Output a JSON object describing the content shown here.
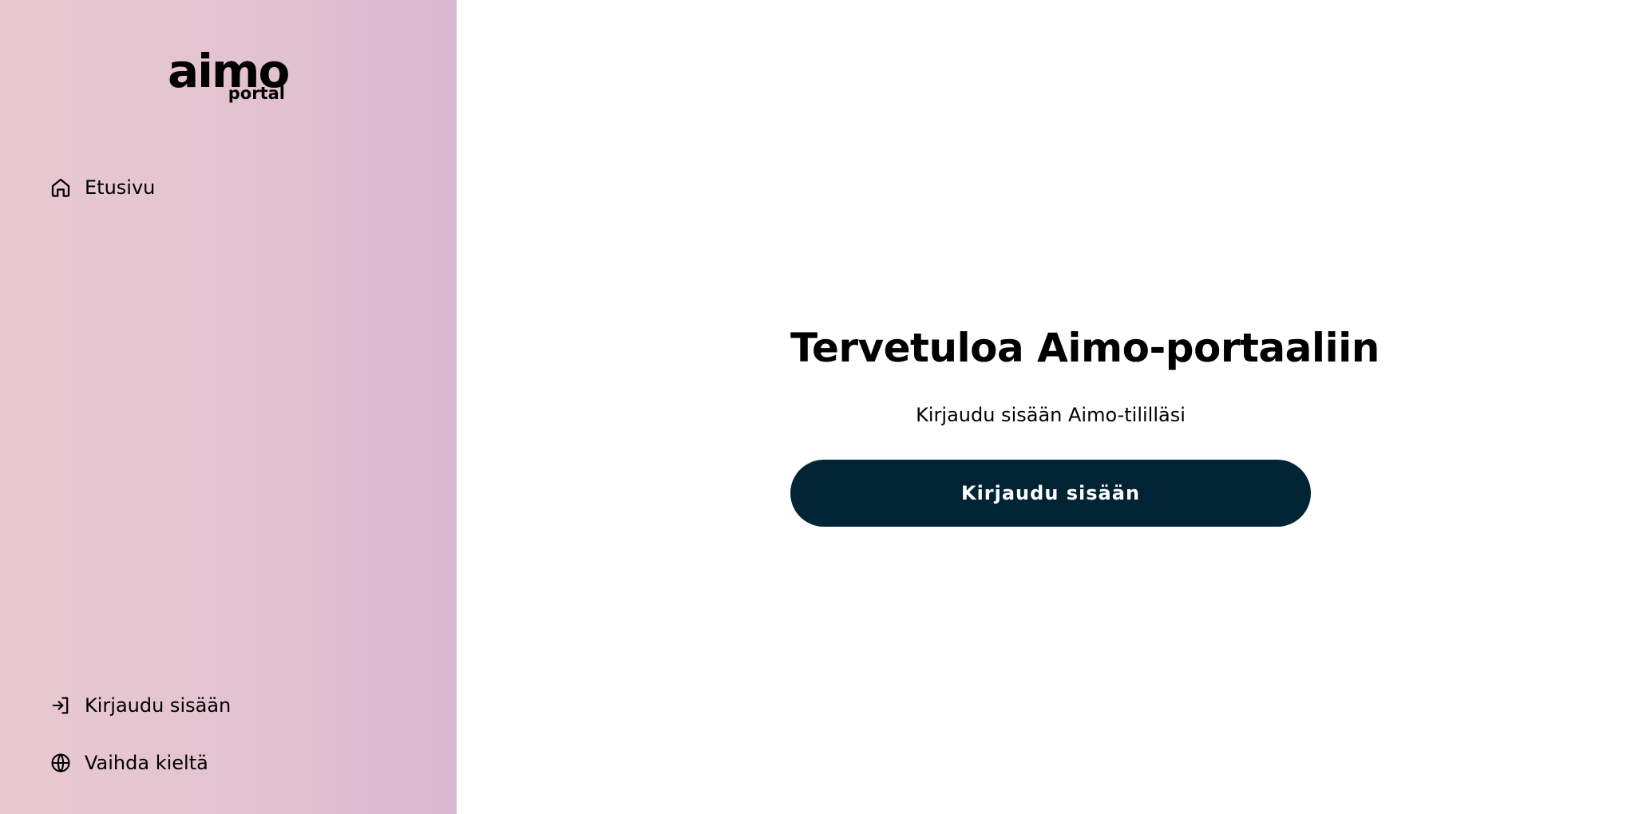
{
  "brand": {
    "logo_main": "aimo",
    "logo_sub": "portal",
    "accent_color": "#002433",
    "sidebar_gradient": [
      "#e8c9d1",
      "#d9b8d0"
    ]
  },
  "sidebar": {
    "top_items": [
      {
        "label": "Etusivu",
        "icon": "home-icon"
      }
    ],
    "bottom_items": [
      {
        "label": "Kirjaudu sisään",
        "icon": "login-icon"
      },
      {
        "label": "Vaihda kieltä",
        "icon": "globe-icon"
      }
    ]
  },
  "main": {
    "title": "Tervetuloa Aimo-portaaliin",
    "subtitle": "Kirjaudu sisään Aimo-tililläsi",
    "login_button_label": "Kirjaudu sisään"
  }
}
